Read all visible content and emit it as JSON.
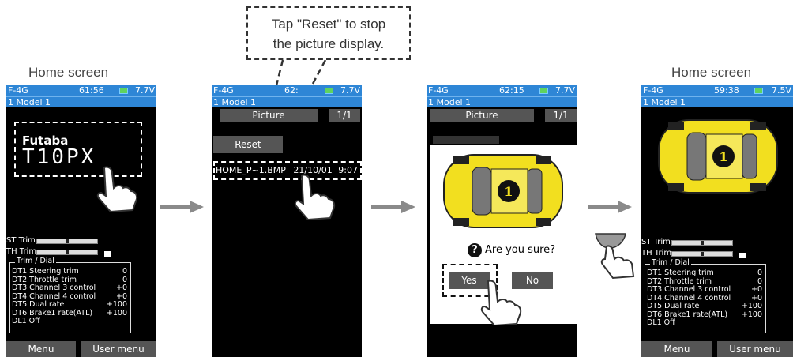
{
  "captions": {
    "home_left": "Home screen",
    "home_right": "Home screen",
    "callout_line1": "Tap \"Reset\" to stop",
    "callout_line2": "the picture display."
  },
  "screen1": {
    "status_left": "F-4G",
    "time": "61:56",
    "voltage": "7.7V",
    "model": "1   Model 1",
    "logo_brand": "Futaba",
    "logo_model": "T10PX",
    "trim_st": "ST Trim",
    "trim_th": "TH Trim",
    "dial_title": "Trim / Dial",
    "menu": "Menu",
    "user_menu": "User menu"
  },
  "screen2": {
    "status_left": "F-4G",
    "time": "62:",
    "voltage": "7.7V",
    "model": "1   Model 1",
    "picture": "Picture",
    "page": "1/1",
    "reset": "Reset",
    "file": "HOME_P~1.BMP",
    "date": "21/10/01",
    "time_of_file": "9:07"
  },
  "screen3": {
    "status_left": "F-4G",
    "time": "62:15",
    "voltage": "7.7V",
    "model": "1   Model 1",
    "picture": "Picture",
    "page": "1/1",
    "question": "Are you sure?",
    "yes": "Yes",
    "no": "No"
  },
  "screen4": {
    "status_left": "F-4G",
    "time": "59:38",
    "voltage": "7.5V",
    "model": "1   Model 1",
    "trim_st": "ST Trim",
    "trim_th": "TH Trim",
    "dial_title": "Trim / Dial",
    "menu": "Menu",
    "user_menu": "User menu"
  },
  "dial_rows": [
    {
      "key": "DT1  Steering trim",
      "value": "0"
    },
    {
      "key": "DT2  Throttle trim",
      "value": "0"
    },
    {
      "key": "DT3  Channel 3 control",
      "value": "+0"
    },
    {
      "key": "DT4  Channel 4 control",
      "value": "+0"
    },
    {
      "key": "DT5  Dual rate",
      "value": "+100"
    },
    {
      "key": "DT6  Brake1 rate(ATL)",
      "value": "+100"
    },
    {
      "key": "DL1  Off",
      "value": ""
    }
  ],
  "colors": {
    "status_blue": "#2e86d6",
    "arrow_gray": "#8a8a8a",
    "car_yellow": "#f2df1f"
  }
}
